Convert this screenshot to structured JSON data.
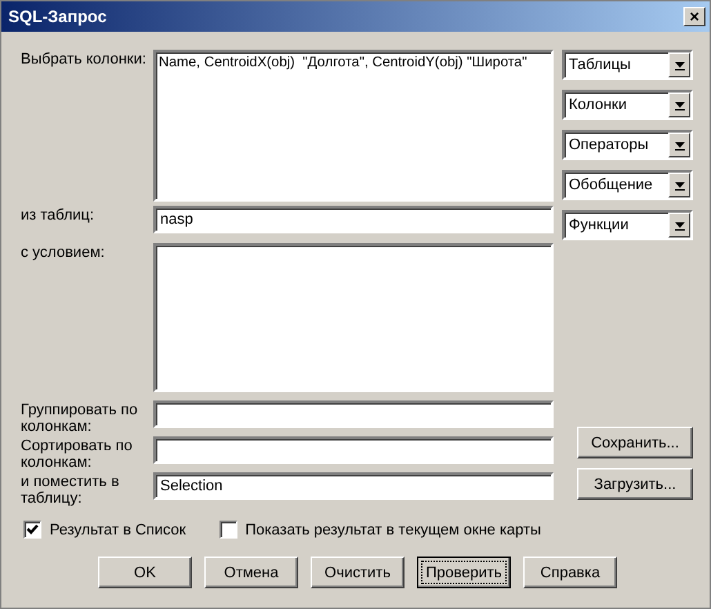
{
  "window": {
    "title": "SQL-Запрос",
    "close": "×"
  },
  "fields": [
    {
      "kind": "area",
      "label": "Выбрать колонки:",
      "value": "Name, CentroidX(obj)  \"Долгота\", CentroidY(obj) \"Широта\""
    },
    {
      "kind": "line",
      "label": "из таблиц:",
      "value": "nasp"
    },
    {
      "kind": "area",
      "label": "с условием:"
    },
    {
      "kind": "line",
      "label": "Группировать по колонкам:"
    },
    {
      "kind": "line",
      "label": "Сортировать по колонкам:"
    },
    {
      "kind": "line",
      "label": "и поместить в таблицу:",
      "value": "Selection"
    }
  ],
  "dropdowns": [
    "Таблицы",
    "Колонки",
    "Операторы",
    "Обобщение",
    "Функции"
  ],
  "side_buttons": [
    "Сохранить...",
    "Загрузить..."
  ],
  "checkboxes": [
    {
      "label": "Результат в Список",
      "checked": true
    },
    {
      "label": "Показать результат в текущем окне карты",
      "checked": false
    }
  ],
  "buttons": [
    {
      "label": "OK",
      "focused": false
    },
    {
      "label": "Отмена",
      "focused": false
    },
    {
      "label": "Очистить",
      "focused": false
    },
    {
      "label": "Проверить",
      "focused": true
    },
    {
      "label": "Справка",
      "focused": false
    }
  ]
}
